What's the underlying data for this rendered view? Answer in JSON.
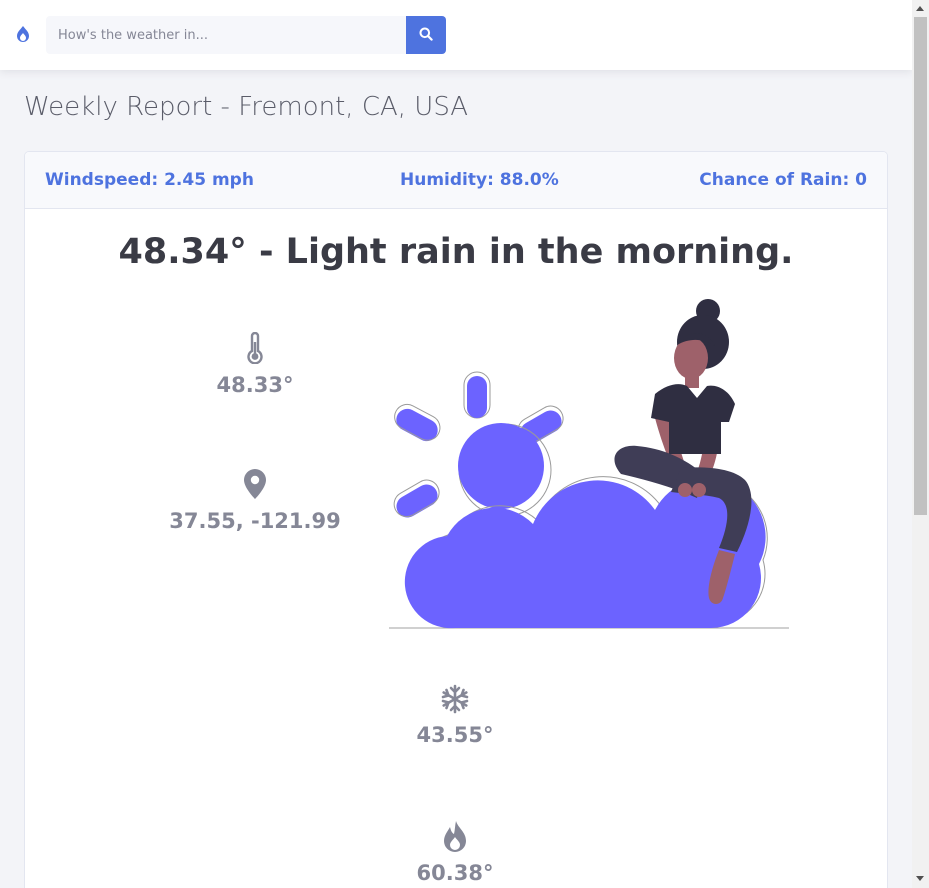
{
  "search": {
    "placeholder": "How's the weather in..."
  },
  "icons": {
    "logo": "app-logo-icon",
    "search": "search-icon",
    "temperature": "thermometer-icon",
    "location": "map-marker-icon",
    "low": "snowflake-icon",
    "high": "fire-icon"
  },
  "report": {
    "title": "Weekly Report - Fremont, CA, USA",
    "windspeed": "Windspeed: 2.45 mph",
    "humidity": "Humidity: 88.0%",
    "chance_of_rain": "Chance of Rain: 0",
    "headline": "48.34° - Light rain in the morning.",
    "current_temp": "48.33°",
    "coordinates": "37.55, -121.99",
    "low_temp": "43.55°",
    "high_temp": "60.38°"
  },
  "colors": {
    "accent": "#4e73df",
    "illustration": "#6c63ff",
    "muted_text": "#858796",
    "dark_text": "#3a3b45"
  }
}
